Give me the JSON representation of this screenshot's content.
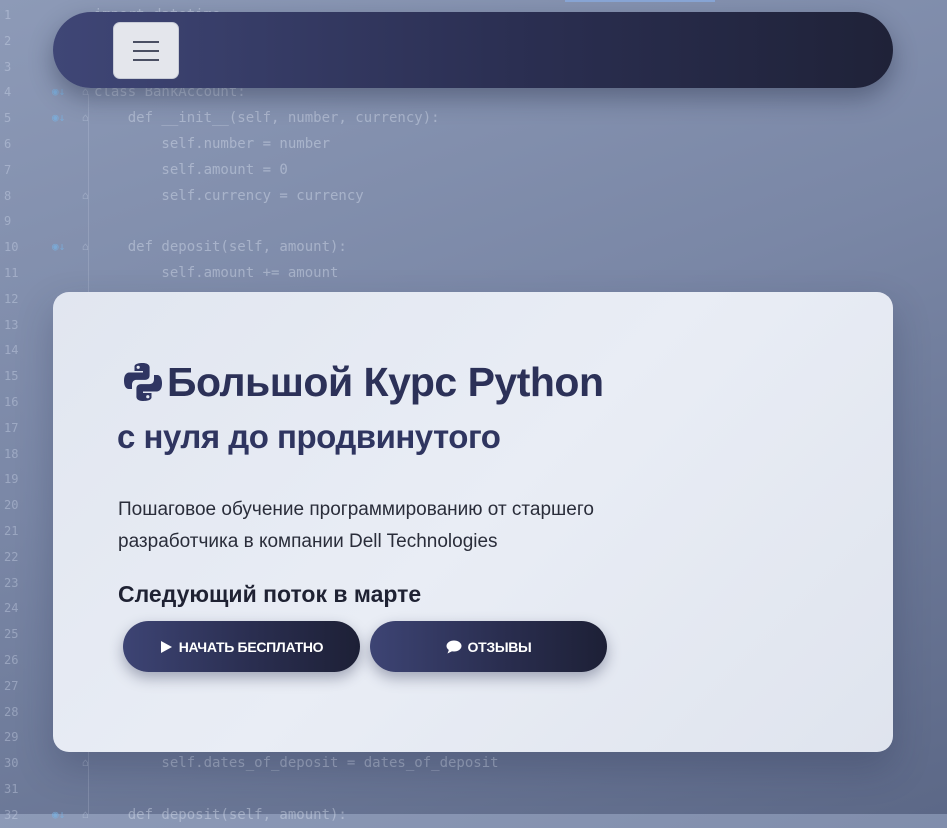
{
  "code_background": {
    "lines": [
      {
        "n": "1",
        "text": "import datetime"
      },
      {
        "n": "2",
        "text": ""
      },
      {
        "n": "3",
        "text": ""
      },
      {
        "n": "4",
        "text": "class BankAccount:"
      },
      {
        "n": "5",
        "text": "    def __init__(self, number, currency):"
      },
      {
        "n": "6",
        "text": "        self.number = number"
      },
      {
        "n": "7",
        "text": "        self.amount = 0"
      },
      {
        "n": "8",
        "text": "        self.currency = currency"
      },
      {
        "n": "9",
        "text": ""
      },
      {
        "n": "10",
        "text": "    def deposit(self, amount):"
      },
      {
        "n": "11",
        "text": "        self.amount += amount"
      },
      {
        "n": "12",
        "text": ""
      },
      {
        "n": "13",
        "text": ""
      },
      {
        "n": "14",
        "text": ""
      },
      {
        "n": "15",
        "text": ""
      },
      {
        "n": "16",
        "text": ""
      },
      {
        "n": "17",
        "text": ""
      },
      {
        "n": "18",
        "text": ""
      },
      {
        "n": "19",
        "text": ""
      },
      {
        "n": "20",
        "text": ""
      },
      {
        "n": "21",
        "text": ""
      },
      {
        "n": "22",
        "text": ""
      },
      {
        "n": "23",
        "text": ""
      },
      {
        "n": "24",
        "text": ""
      },
      {
        "n": "25",
        "text": ""
      },
      {
        "n": "26",
        "text": ""
      },
      {
        "n": "27",
        "text": ""
      },
      {
        "n": "28",
        "text": ""
      },
      {
        "n": "29",
        "text": ""
      },
      {
        "n": "30",
        "text": "        self.dates_of_deposit = dates_of_deposit"
      },
      {
        "n": "31",
        "text": ""
      },
      {
        "n": "32",
        "text": "    def deposit(self, amount):"
      }
    ]
  },
  "navbar": {
    "menu_icon": "hamburger-icon"
  },
  "hero": {
    "logo_icon": "python-logo-icon",
    "title": "Большой Курс Python",
    "subtitle": "с нуля до продвинутого",
    "description": "Пошаговое обучение программированию от старшего разработчика в компании Dell Technologies",
    "next_stream": "Следующий поток в марте",
    "buttons": {
      "start_label": "НАЧАТЬ БЕСПЛАТНО",
      "start_icon": "play-icon",
      "reviews_label": "ОТЗЫВЫ",
      "reviews_icon": "comment-icon"
    }
  },
  "colors": {
    "primary_dark": "#2c3158",
    "card_bg": "#e6eaf2",
    "button_gradient_start": "#3d4474",
    "button_gradient_end": "#1d2036"
  }
}
